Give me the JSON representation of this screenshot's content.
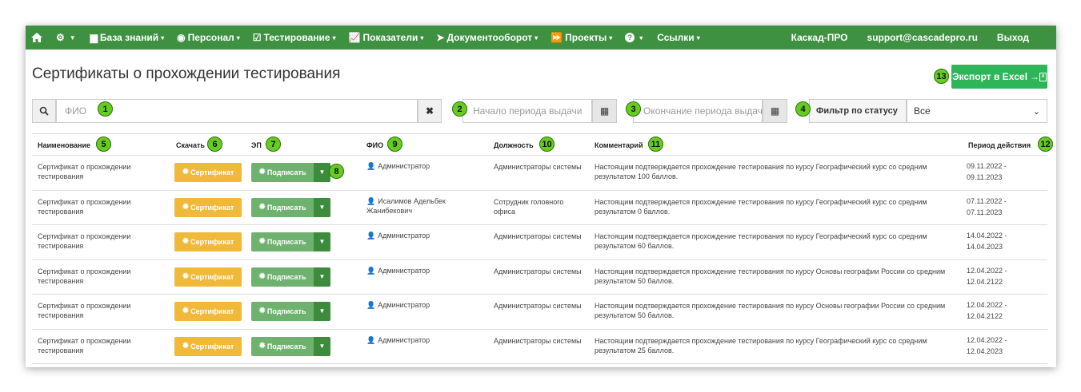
{
  "nav": {
    "home_icon": "home-icon",
    "settings_icon": "gear-icon",
    "items": [
      {
        "label": "База знаний",
        "icon": "book-icon"
      },
      {
        "label": "Персонал",
        "icon": "person-circle-icon"
      },
      {
        "label": "Тестирование",
        "icon": "checkbox-icon"
      },
      {
        "label": "Показатели",
        "icon": "chart-icon"
      },
      {
        "label": "Документооборот",
        "icon": "send-icon"
      },
      {
        "label": "Проекты",
        "icon": "forward-icon"
      },
      {
        "label": "?",
        "icon": "help-icon"
      },
      {
        "label": "Ссылки",
        "icon": ""
      }
    ],
    "right": [
      "Каскад-ПРО",
      "support@cascadepro.ru",
      "Выход"
    ]
  },
  "page": {
    "title": "Сертификаты о прохождении тестирования",
    "export_label": "Экспорт в Excel"
  },
  "filters": {
    "fio_placeholder": "ФИО",
    "start_placeholder": "Начало периода выдачи",
    "end_placeholder": "Окончание периода выдачи",
    "status_label": "Фильтр по статусу",
    "status_value": "Все"
  },
  "table": {
    "headers": [
      "Наименование",
      "Скачать",
      "ЭП",
      "ФИО",
      "Должность",
      "Комментарий",
      "Период действия"
    ],
    "cert_label": "Сертификат",
    "sign_label": "Подписать",
    "rows": [
      {
        "name": "Сертификат о прохождении тестирования",
        "fio": "Администратор",
        "position": "Администраторы системы",
        "comment": "Настоящим подтверждается прохождение тестирования по курсу Географический курс со средним результатом 100 баллов.",
        "period_from": "09.11.2022",
        "period_to": "09.11.2023"
      },
      {
        "name": "Сертификат о прохождении тестирования",
        "fio": "Исалимов Адельбек Жанибекович",
        "position": "Сотрудник головного офиса",
        "comment": "Настоящим подтверждается прохождение тестирования по курсу Географический курс со средним результатом 0 баллов.",
        "period_from": "07.11.2022",
        "period_to": "07.11.2023"
      },
      {
        "name": "Сертификат о прохождении тестирования",
        "fio": "Администратор",
        "position": "Администраторы системы",
        "comment": "Настоящим подтверждается прохождение тестирования по курсу Географический курс со средним результатом 60 баллов.",
        "period_from": "14.04.2022",
        "period_to": "14.04.2023"
      },
      {
        "name": "Сертификат о прохождении тестирования",
        "fio": "Администратор",
        "position": "Администраторы системы",
        "comment": "Настоящим подтверждается прохождение тестирования по курсу Основы географии России со средним результатом 50 баллов.",
        "period_from": "12.04.2022",
        "period_to": "12.04.2122"
      },
      {
        "name": "Сертификат о прохождении тестирования",
        "fio": "Администратор",
        "position": "Администраторы системы",
        "comment": "Настоящим подтверждается прохождение тестирования по курсу Основы географии России со средним результатом 50 баллов.",
        "period_from": "12.04.2022",
        "period_to": "12.04.2122"
      },
      {
        "name": "Сертификат о прохождении тестирования",
        "fio": "Администратор",
        "position": "Администраторы системы",
        "comment": "Настоящим подтверждается прохождение тестирования по курсу Географический курс со средним результатом 25 баллов.",
        "period_from": "12.04.2022",
        "period_to": "12.04.2023"
      }
    ]
  },
  "badges": [
    "1",
    "2",
    "3",
    "4",
    "5",
    "6",
    "7",
    "8",
    "9",
    "10",
    "11",
    "12",
    "13"
  ],
  "colors": {
    "nav": "#3f9142",
    "export": "#2eb55a",
    "certificate": "#f0b93a",
    "sign": "#6fb26f",
    "sign_dropdown": "#3d8b3d",
    "badge": "#66cc22"
  }
}
